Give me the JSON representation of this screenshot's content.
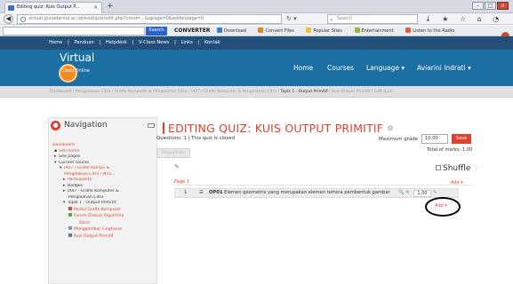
{
  "browser": {
    "tab_title": "Editing quiz: Kuis Output P...",
    "tab_close": "×",
    "new_tab": "+",
    "url": "virtual.gunadarma.ac.id/mod/quiz/edit.php?cmid=...&qpage=0&addonpage=0",
    "search_placeholder": "Search",
    "nav_icons": "↓ ★ ☆ ⌂ ◔ ⋮",
    "window_buttons": {
      "min": "–",
      "max": "□",
      "close": "×"
    }
  },
  "toolbar": {
    "search_button": "Search",
    "converter": "CONVERTER",
    "items": [
      {
        "label": "Download",
        "color": "#3b7bd6"
      },
      {
        "label": "Convert Files",
        "color": "#d88a2d"
      },
      {
        "label": "Popular Sites",
        "color": "#f2c12e"
      },
      {
        "label": "Entertainment",
        "color": "#8fbc3a"
      },
      {
        "label": "Listen to the Radio",
        "color": "#e25e3b"
      }
    ]
  },
  "site": {
    "top_nav": [
      "Home",
      "|",
      "Panduan",
      "|",
      "Helpdesk",
      "|",
      "V-Class News",
      "|",
      "Links",
      "|",
      "Kontak"
    ],
    "logo_title": "Virtual",
    "logo_sub": "Class Online",
    "menu": [
      "Home",
      "Courses",
      "Language ▾",
      "Aviarini Indrati ▾"
    ],
    "breadcrumb_prefix": "Dashboard / Pengelolaan Citra / Grafik Komputer & Pengolahan Citra / IA07 / Grafik Komputer & Pengolahan Citra / ",
    "breadcrumb_current": "Topik 1 : Output Primitif",
    "breadcrumb_suffix": " / Kuis Output Primitif / Edit quiz"
  },
  "navigation": {
    "title": "Navigation",
    "items": [
      {
        "label": "Dashboard",
        "style": "link",
        "bullet": ""
      },
      {
        "label": "Site home",
        "style": "link",
        "bullet": "▪"
      },
      {
        "label": "Site pages",
        "style": "dark",
        "bullet": "▸"
      },
      {
        "label": "Current course",
        "style": "dark",
        "bullet": "▾"
      },
      {
        "label": "IA07 / Grafik Kompu &",
        "style": "link",
        "bullet": "▾"
      },
      {
        "label": "Pengolahan Citra / NTS...",
        "style": "link",
        "bullet": ""
      },
      {
        "label": "Participants",
        "style": "link",
        "bullet": "▸"
      },
      {
        "label": "Badges",
        "style": "dark",
        "bullet": "▸"
      },
      {
        "label": "IA07 - Grafik Komputer &",
        "style": "dark",
        "bullet": "▸"
      },
      {
        "label": "Pengolahan Citra",
        "style": "dark",
        "bullet": ""
      },
      {
        "label": "Topik 1 : Output Primitif",
        "style": "dark",
        "bullet": "▾"
      },
      {
        "label": "Modul Grafik Komputer",
        "style": "link",
        "icon_color": "#d8472f"
      },
      {
        "label": "Forum Diskusi Algoritma",
        "style": "link",
        "icon_color": "#5aa64b"
      },
      {
        "label": "Garis",
        "style": "link",
        "icon_color": ""
      },
      {
        "label": "Menggambar Lingkaran",
        "style": "link",
        "icon_color": "#7a9ab8"
      },
      {
        "label": "Kuis Output Primitif",
        "style": "link",
        "icon_color": "#5c77a7"
      }
    ]
  },
  "quiz": {
    "title": "EDITING QUIZ: KUIS OUTPUT PRIMITIF",
    "info": "Questions: 1 | This quiz is closed",
    "max_grade_label": "Maximum grade",
    "max_grade_value": "10.00",
    "save_button": "Save",
    "total_marks": "Total of marks: 1.00",
    "repaginate_button": "Repaginate",
    "shuffle_label": "Shuffle",
    "page_label": "Page 1",
    "add_label_top": "Add ▾",
    "add_label_bottom": "Add ▾",
    "question": {
      "number": "1",
      "type_icon": "☰",
      "name": "OP01",
      "text": "Elemen geometris yang merupakan elemen tertera pembentuk gambar",
      "actions": "🔍 ✕",
      "mark": "1.00"
    }
  }
}
